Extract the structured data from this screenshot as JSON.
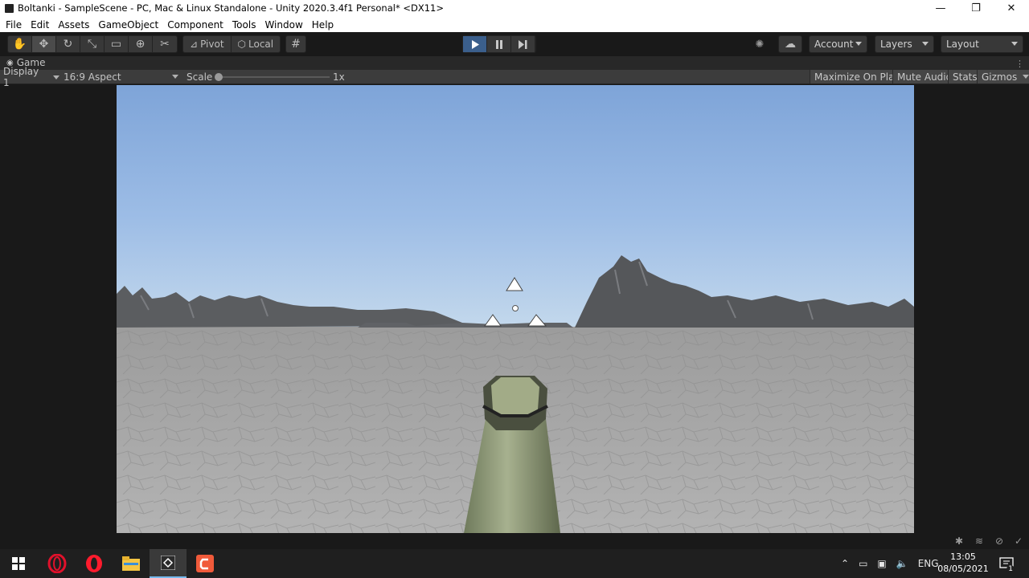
{
  "window": {
    "title": "Boltanki - SampleScene - PC, Mac & Linux Standalone - Unity 2020.3.4f1 Personal* <DX11>",
    "controls": [
      "—",
      "❐",
      "✕"
    ]
  },
  "menu": [
    "File",
    "Edit",
    "Assets",
    "GameObject",
    "Component",
    "Tools",
    "Window",
    "Help"
  ],
  "toolbar": {
    "pivot_label": "Pivot",
    "local_label": "Local",
    "account_label": "Account",
    "layers_label": "Layers",
    "layout_label": "Layout"
  },
  "game_tab": {
    "label": "Game"
  },
  "game_bar": {
    "display": "Display 1",
    "aspect": "16:9 Aspect",
    "scale_label": "Scale",
    "scale_value": "1x",
    "maximize_on_play": "Maximize On Play",
    "mute_audio": "Mute Audio",
    "stats": "Stats",
    "gizmos": "Gizmos"
  },
  "taskbar": {
    "language": "ENG",
    "time": "13:05",
    "date": "08/05/2021",
    "notifications_count": "1"
  },
  "colors": {
    "sky_top": "#7fa5d9",
    "sky_bottom": "#b9d2ea",
    "ground": "#a7a7a7",
    "play_active": "#3b5f8c",
    "barrel": "#8f9a78"
  }
}
